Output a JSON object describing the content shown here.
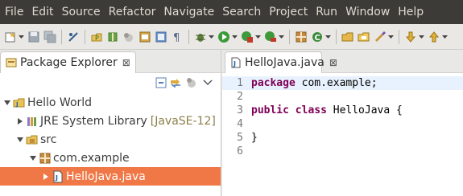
{
  "menubar": {
    "items": [
      "File",
      "Edit",
      "Source",
      "Refactor",
      "Navigate",
      "Search",
      "Project",
      "Run",
      "Window",
      "Help"
    ]
  },
  "toolbar": {
    "icons": [
      "new-wizard-icon",
      "save-icon",
      "save-all-icon",
      "skip-breakpoints-icon",
      "new-java-project-icon",
      "new-package-icon",
      "new-class-icon",
      "open-type-icon",
      "paragraph-icon",
      "debug-icon",
      "run-icon",
      "coverage-icon",
      "external-tools-icon",
      "new-java-package-icon",
      "new-java-class-icon",
      "open-folder-icon",
      "open-file-icon",
      "search-icon",
      "next-annotation-icon",
      "previous-annotation-icon"
    ]
  },
  "package_explorer": {
    "title": "Package Explorer",
    "close_glyph": "⊠",
    "tree": [
      {
        "label": "Hello World",
        "icon": "java-project-icon",
        "twisty": "expanded"
      },
      {
        "label": "JRE System Library",
        "decoration": "[JavaSE-12]",
        "icon": "library-icon",
        "twisty": "collapsed"
      },
      {
        "label": "src",
        "icon": "source-folder-icon",
        "twisty": "expanded"
      },
      {
        "label": "com.example",
        "icon": "package-icon",
        "twisty": "expanded"
      },
      {
        "label": "HelloJava.java",
        "icon": "java-file-icon",
        "twisty": "collapsed",
        "selected": true
      }
    ]
  },
  "editor": {
    "tab_title": "HelloJava.java",
    "close_glyph": "⊠",
    "lines": [
      {
        "num": "1",
        "kw": "package",
        "rest": " com.example;"
      },
      {
        "num": "2",
        "kw": "",
        "rest": ""
      },
      {
        "num": "3",
        "kw": "public class",
        "rest": " HelloJava {"
      },
      {
        "num": "4",
        "kw": "",
        "rest": ""
      },
      {
        "num": "5",
        "kw": "",
        "rest": "}"
      },
      {
        "num": "6",
        "kw": "",
        "rest": ""
      }
    ]
  },
  "colors": {
    "menubar_bg": "#3c3b37",
    "selection": "#f07746",
    "keyword": "#7f0055",
    "current_line": "#e8f2fe"
  }
}
